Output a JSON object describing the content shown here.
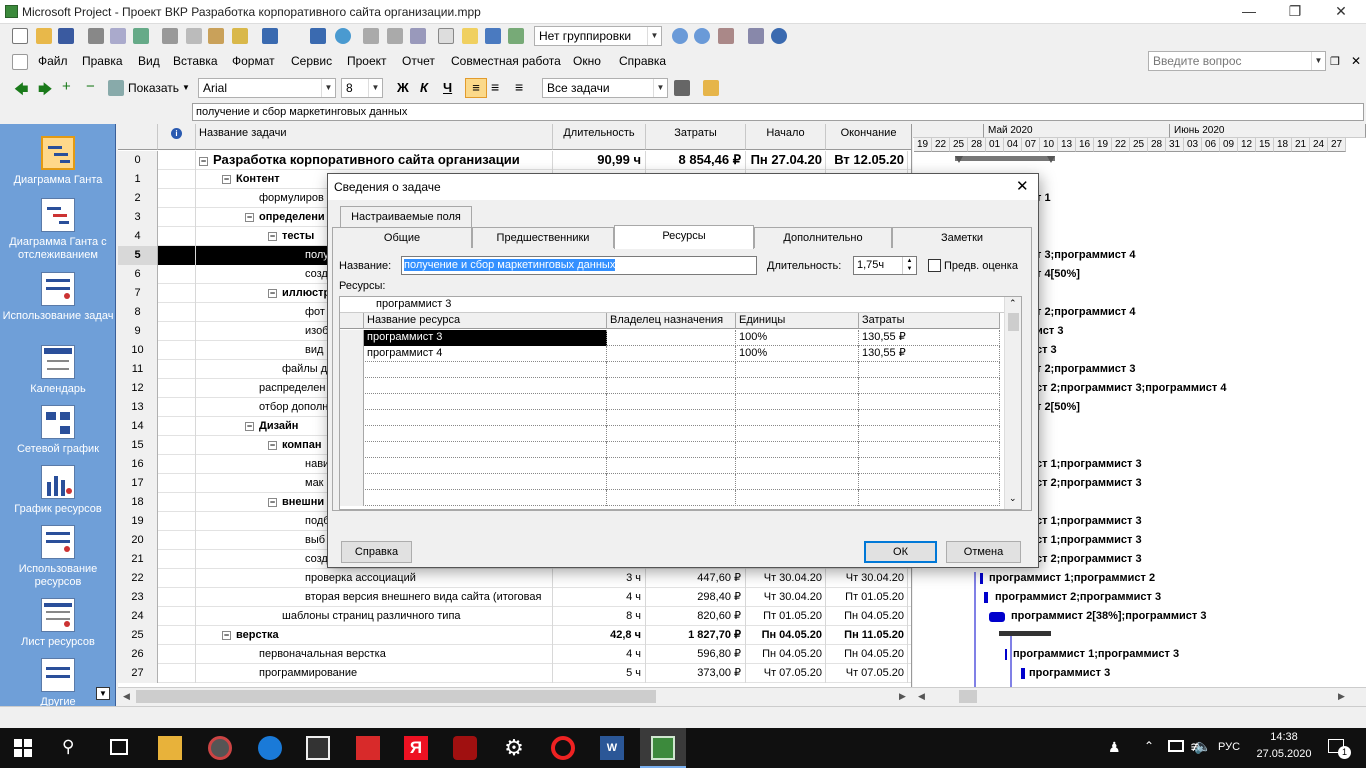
{
  "window": {
    "title": "Microsoft Project - Проект ВКР Разработка корпоративного сайта организации.mpp"
  },
  "toolbar": {
    "grouping": "Нет группировки"
  },
  "menu": {
    "items": [
      "Файл",
      "Правка",
      "Вид",
      "Вставка",
      "Формат",
      "Сервис",
      "Проект",
      "Отчет",
      "Совместная работа",
      "Окно",
      "Справка"
    ],
    "ask_placeholder": "Введите вопрос"
  },
  "format": {
    "show_label": "Показать",
    "font": "Arial",
    "size": "8",
    "bold": "Ж",
    "italic": "К",
    "underline": "Ч",
    "filter": "Все задачи"
  },
  "entry_value": "получение и сбор маркетинговых данных",
  "viewbar": {
    "items": [
      "Диаграмма Ганта",
      "Диаграмма Ганта с отслеживанием",
      "Использование задач",
      "Календарь",
      "Сетевой график",
      "График ресурсов",
      "Использование ресурсов",
      "Лист ресурсов",
      "Другие"
    ]
  },
  "table": {
    "headers": {
      "name": "Название задачи",
      "duration": "Длительность",
      "cost": "Затраты",
      "start": "Начало",
      "finish": "Окончание"
    },
    "rows": [
      {
        "id": "0",
        "name": "Разработка корпоративного сайта организации",
        "dur": "90,99 ч",
        "cost": "8 854,46 ₽",
        "start": "Пн 27.04.20",
        "fin": "Вт 12.05.20"
      },
      {
        "id": "1",
        "name": "Контент",
        "dur": "",
        "cost": "",
        "start": "",
        "fin": ""
      },
      {
        "id": "2",
        "name": "формулиров",
        "dur": "",
        "cost": "",
        "start": "",
        "fin": ""
      },
      {
        "id": "3",
        "name": "определени",
        "dur": "",
        "cost": "",
        "start": "",
        "fin": ""
      },
      {
        "id": "4",
        "name": "тесты",
        "dur": "",
        "cost": "",
        "start": "",
        "fin": ""
      },
      {
        "id": "5",
        "name": "полу",
        "dur": "",
        "cost": "",
        "start": "",
        "fin": ""
      },
      {
        "id": "6",
        "name": "созд",
        "dur": "",
        "cost": "",
        "start": "",
        "fin": ""
      },
      {
        "id": "7",
        "name": "иллюстр",
        "dur": "",
        "cost": "",
        "start": "",
        "fin": ""
      },
      {
        "id": "8",
        "name": "фот",
        "dur": "",
        "cost": "",
        "start": "",
        "fin": ""
      },
      {
        "id": "9",
        "name": "изоб",
        "dur": "",
        "cost": "",
        "start": "",
        "fin": ""
      },
      {
        "id": "10",
        "name": "вид",
        "dur": "",
        "cost": "",
        "start": "",
        "fin": ""
      },
      {
        "id": "11",
        "name": "файлы д",
        "dur": "",
        "cost": "",
        "start": "",
        "fin": ""
      },
      {
        "id": "12",
        "name": "распределен",
        "dur": "",
        "cost": "",
        "start": "",
        "fin": ""
      },
      {
        "id": "13",
        "name": "отбор дополн",
        "dur": "",
        "cost": "",
        "start": "",
        "fin": ""
      },
      {
        "id": "14",
        "name": "Дизайн",
        "dur": "",
        "cost": "",
        "start": "",
        "fin": ""
      },
      {
        "id": "15",
        "name": "компан",
        "dur": "",
        "cost": "",
        "start": "",
        "fin": ""
      },
      {
        "id": "16",
        "name": "нави",
        "dur": "",
        "cost": "",
        "start": "",
        "fin": ""
      },
      {
        "id": "17",
        "name": "мак",
        "dur": "",
        "cost": "",
        "start": "",
        "fin": ""
      },
      {
        "id": "18",
        "name": "внешни",
        "dur": "",
        "cost": "",
        "start": "",
        "fin": ""
      },
      {
        "id": "19",
        "name": "подб",
        "dur": "",
        "cost": "",
        "start": "",
        "fin": ""
      },
      {
        "id": "20",
        "name": "выб",
        "dur": "",
        "cost": "",
        "start": "",
        "fin": ""
      },
      {
        "id": "21",
        "name": "созд",
        "dur": "",
        "cost": "",
        "start": "",
        "fin": ""
      },
      {
        "id": "22",
        "name": "проверка ассоциаций",
        "dur": "3 ч",
        "cost": "447,60 ₽",
        "start": "Чт 30.04.20",
        "fin": "Чт 30.04.20"
      },
      {
        "id": "23",
        "name": "вторая версия внешнего вида сайта (итоговая",
        "dur": "4 ч",
        "cost": "298,40 ₽",
        "start": "Чт 30.04.20",
        "fin": "Пт 01.05.20"
      },
      {
        "id": "24",
        "name": "шаблоны страниц различного типа",
        "dur": "8 ч",
        "cost": "820,60 ₽",
        "start": "Пт 01.05.20",
        "fin": "Пн 04.05.20"
      },
      {
        "id": "25",
        "name": "верстка",
        "dur": "42,8 ч",
        "cost": "1 827,70 ₽",
        "start": "Пн 04.05.20",
        "fin": "Пн 11.05.20"
      },
      {
        "id": "26",
        "name": "первоначальная верстка",
        "dur": "4 ч",
        "cost": "596,80 ₽",
        "start": "Пн 04.05.20",
        "fin": "Пн 04.05.20"
      },
      {
        "id": "27",
        "name": "программирование",
        "dur": "5 ч",
        "cost": "373,00 ₽",
        "start": "Чт 07.05.20",
        "fin": "Чт 07.05.20"
      }
    ]
  },
  "gantt": {
    "months": [
      "Май 2020",
      "Июнь 2020"
    ],
    "days": [
      "19",
      "22",
      "25",
      "28",
      "01",
      "04",
      "07",
      "10",
      "13",
      "16",
      "19",
      "22",
      "25",
      "28",
      "31",
      "03",
      "06",
      "09",
      "12",
      "15",
      "18",
      "21",
      "24",
      "27"
    ],
    "labels": [
      "т 1",
      "т 3;программист 4",
      "т 4[50%]",
      "т 2;программист 4",
      "ист 3",
      "ст 3",
      "т 2;программист 3",
      "ст 2;программист 3;программист 4",
      "т 2[50%]",
      "ст 1;программист 3",
      "ст 2;программист 3",
      "ст 1;программист 3",
      "ст 1;программист 3",
      "ст 2;программист 3",
      "программист 1;программист 2",
      "программист 2;программист 3",
      "программист 2[38%];программист 3",
      "программист 1;программист 3",
      "программист 3"
    ]
  },
  "dialog": {
    "title": "Сведения о задаче",
    "tabs": {
      "custom": "Настраиваемые поля",
      "general": "Общие",
      "predecessors": "Предшественники",
      "resources": "Ресурсы",
      "advanced": "Дополнительно",
      "notes": "Заметки"
    },
    "name_label": "Название:",
    "name_value": "получение и сбор маркетинговых данных",
    "duration_label": "Длительность:",
    "duration_value": "1,75ч",
    "estimate_label": "Предв. оценка",
    "resources_label": "Ресурсы:",
    "grid_edit_value": "программист 3",
    "grid_headers": {
      "name": "Название ресурса",
      "owner": "Владелец назначения",
      "units": "Единицы",
      "cost": "Затраты"
    },
    "grid_rows": [
      {
        "name": "программист 3",
        "owner": "",
        "units": "100%",
        "cost": "130,55 ₽"
      },
      {
        "name": "программист 4",
        "owner": "",
        "units": "100%",
        "cost": "130,55 ₽"
      }
    ],
    "help_button": "Справка",
    "ok_button": "ОК",
    "cancel_button": "Отмена"
  },
  "taskbar": {
    "lang": "РУС",
    "time": "14:38",
    "date": "27.05.2020",
    "notifications": "1"
  },
  "colors": {
    "viewbar": "#6f9fd8",
    "selection": "#000000",
    "dialog_accent": "#0078d7",
    "gantt_bar": "#0000cc"
  }
}
